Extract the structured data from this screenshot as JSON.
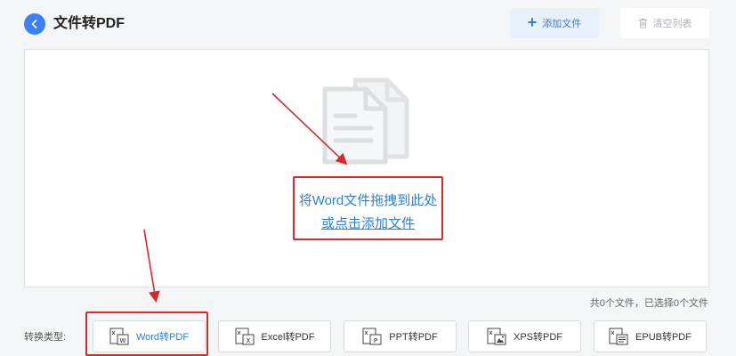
{
  "header": {
    "title": "文件转PDF",
    "add_label": "添加文件",
    "clear_label": "清空列表"
  },
  "dropzone": {
    "hint_primary": "将Word文件拖拽到此处",
    "hint_secondary": "或点击添加文件"
  },
  "status": {
    "file_count": "共0个文件，已选择0个文件"
  },
  "convert": {
    "label": "转换类型:",
    "types": [
      {
        "label": "Word转PDF",
        "icon": "word-doc-icon",
        "active": true
      },
      {
        "label": "Excel转PDF",
        "icon": "excel-doc-icon",
        "active": false
      },
      {
        "label": "PPT转PDF",
        "icon": "ppt-doc-icon",
        "active": false
      },
      {
        "label": "XPS转PDF",
        "icon": "xps-doc-icon",
        "active": false
      },
      {
        "label": "EPUB转PDF",
        "icon": "epub-doc-icon",
        "active": false
      }
    ]
  },
  "colors": {
    "accent": "#3b82f6",
    "link": "#2f80d1",
    "annotation_red": "#d42b2b"
  }
}
